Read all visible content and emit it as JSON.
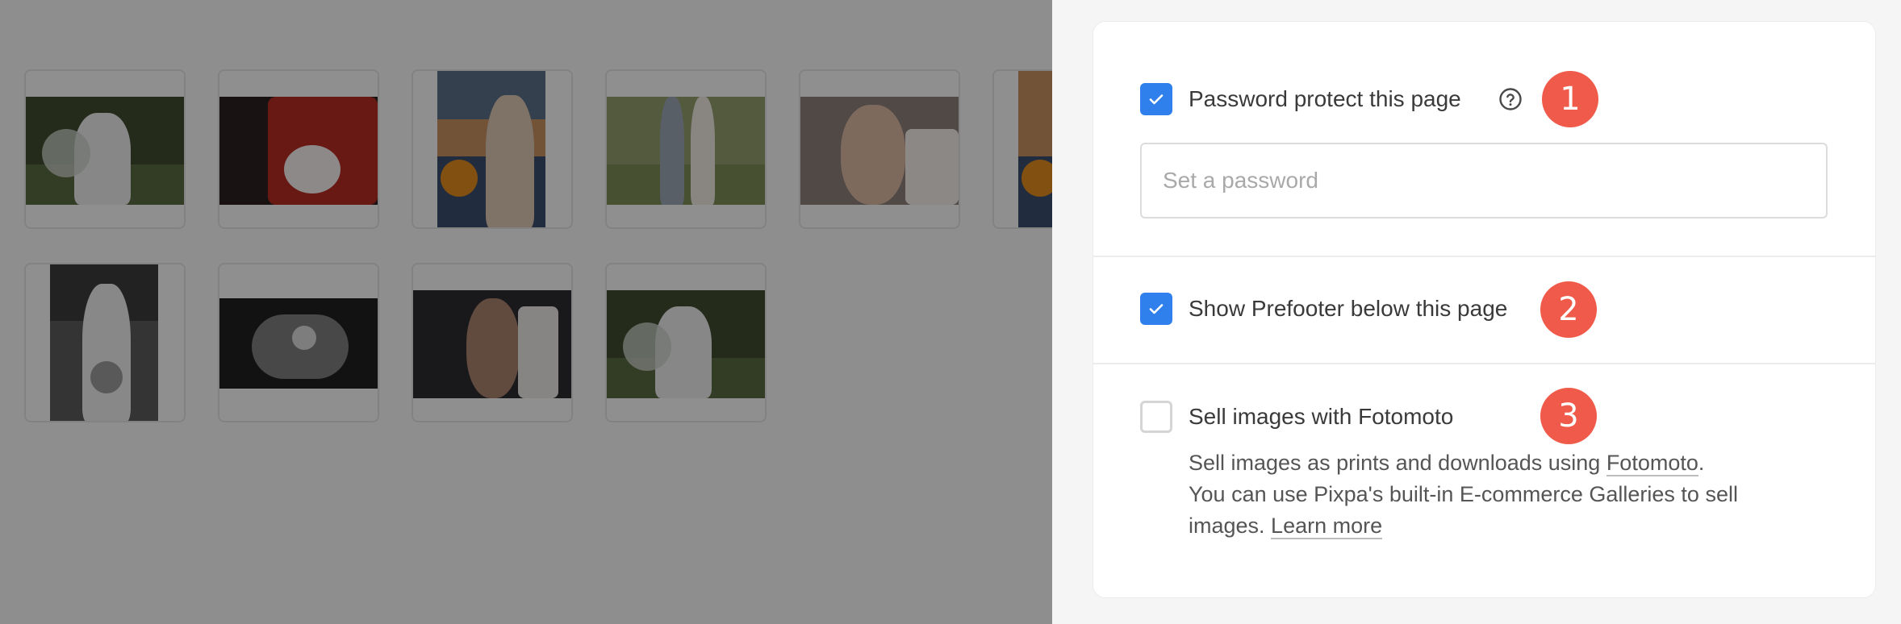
{
  "gallery": {
    "rows": [
      [
        {
          "name": "bride-veil-outdoor",
          "scheme": [
            "#3e4a2e",
            "#c9d0c8",
            "#e8e8ea"
          ]
        },
        {
          "name": "red-dress-bouquet",
          "scheme": [
            "#2a2220",
            "#b52c22",
            "#f1ecea"
          ]
        },
        {
          "name": "bride-in-car",
          "scheme": [
            "#3a4f6b",
            "#c58f61",
            "#d9c7b0"
          ]
        },
        {
          "name": "couple-walking",
          "scheme": [
            "#7a8a54",
            "#9aa4b0",
            "#ece6df"
          ]
        },
        {
          "name": "bride-portrait",
          "scheme": [
            "#8a7f78",
            "#d8b7a1",
            "#f1ebe6"
          ]
        },
        {
          "name": "bride-in-car-partial",
          "scheme": [
            "#3a4f6b",
            "#c58f61",
            "#d9c7b0"
          ]
        }
      ],
      [
        {
          "name": "bw-bride-bouquet",
          "scheme": [
            "#3c3c3c",
            "#9a9a9a",
            "#eaeaea"
          ]
        },
        {
          "name": "bw-hands-rings",
          "scheme": [
            "#1f1f1f",
            "#7d7d7d",
            "#d8d8d8"
          ]
        },
        {
          "name": "bride-laughing",
          "scheme": [
            "#2b2b30",
            "#a8806c",
            "#e8e4e4"
          ]
        },
        {
          "name": "bride-veil-outdoor-2",
          "scheme": [
            "#3e4a2e",
            "#c9d0c8",
            "#e8e8ea"
          ]
        }
      ]
    ]
  },
  "settings": {
    "password": {
      "checked": true,
      "label": "Password protect this page",
      "placeholder": "Set a password",
      "value": "",
      "help_icon": "question-circle-icon",
      "badge": "1"
    },
    "prefooter": {
      "checked": true,
      "label": "Show Prefooter below this page",
      "badge": "2"
    },
    "fotomoto": {
      "checked": false,
      "label": "Sell images with Fotomoto",
      "badge": "3",
      "desc_line1_prefix": "Sell images as prints and downloads using ",
      "desc_link_fotomoto": "Fotomoto",
      "desc_line1_suffix": ".",
      "desc_line2": "You can use Pixpa's built-in E-commerce Galleries to sell images. ",
      "desc_link_learn": "Learn more"
    }
  },
  "colors": {
    "accent": "#2f80ed",
    "badge": "#f05a4a"
  }
}
